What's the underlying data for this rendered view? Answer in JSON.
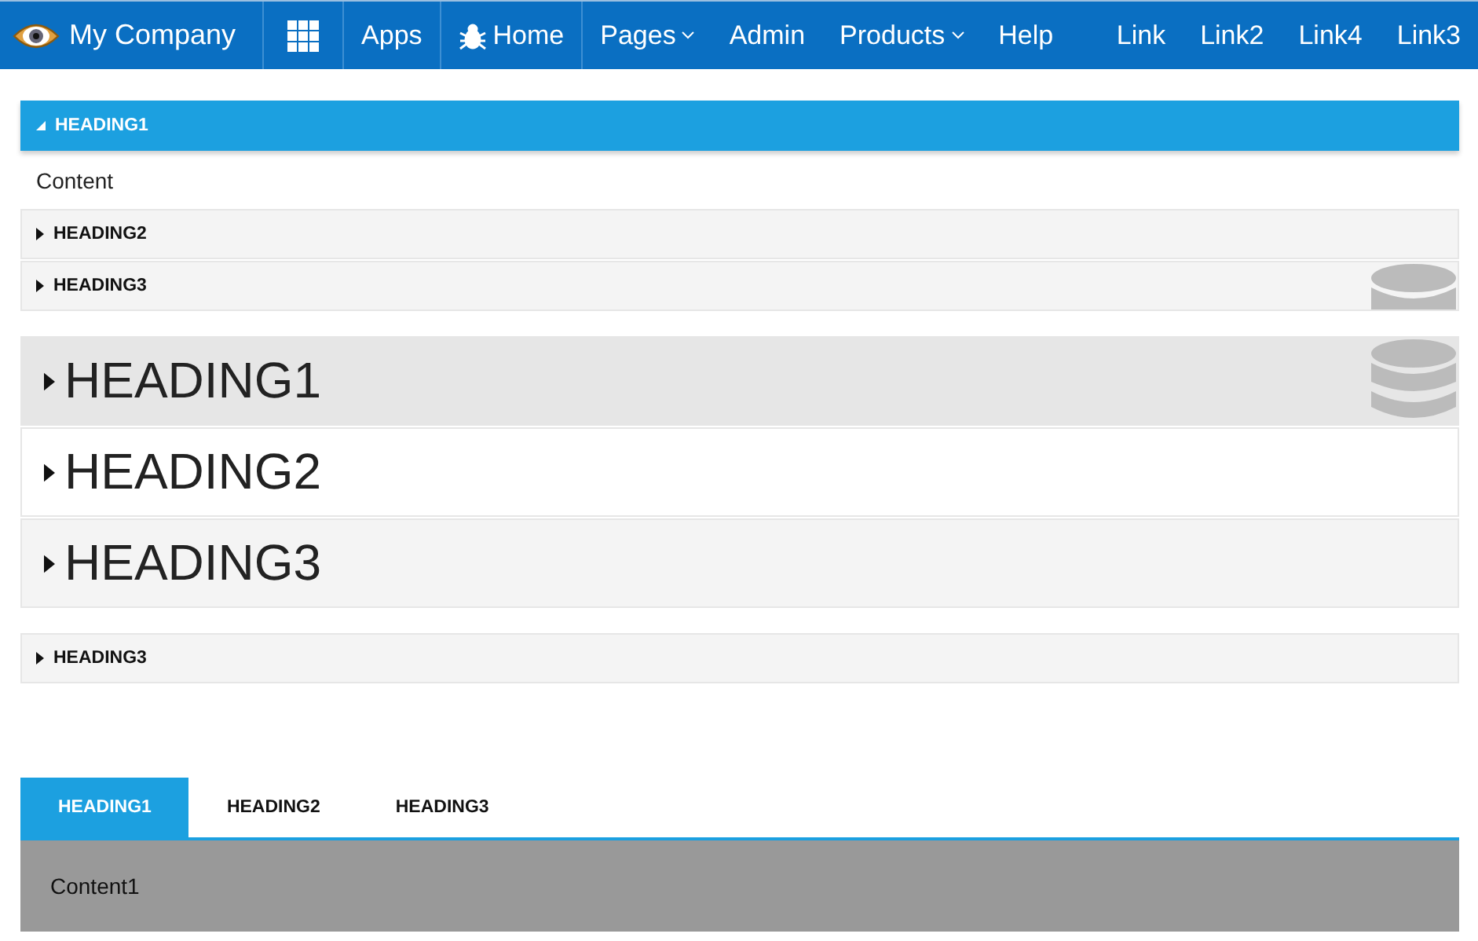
{
  "navbar": {
    "brand": "My Company",
    "items": [
      {
        "label": "Apps",
        "dropdown": false,
        "separated": true
      },
      {
        "label": "Home",
        "dropdown": false,
        "separated": true
      },
      {
        "label": "Pages",
        "dropdown": true
      },
      {
        "label": "Admin",
        "dropdown": false
      },
      {
        "label": "Products",
        "dropdown": true
      },
      {
        "label": "Help",
        "dropdown": false
      }
    ],
    "links": [
      "Link",
      "Link2",
      "Link4",
      "Link3"
    ]
  },
  "accordions": [
    {
      "kind": "small",
      "panels": [
        {
          "heading": "HEADING1",
          "expanded": true,
          "content": "Content"
        },
        {
          "heading": "HEADING2",
          "expanded": false
        },
        {
          "heading": "HEADING3",
          "expanded": false
        }
      ]
    },
    {
      "kind": "large",
      "panels": [
        {
          "heading": "HEADING1",
          "expanded": false,
          "hovered": true
        },
        {
          "heading": "HEADING2",
          "expanded": false,
          "hovered": false
        },
        {
          "heading": "HEADING3",
          "expanded": false,
          "hovered": false
        }
      ]
    },
    {
      "kind": "small",
      "panels": [
        {
          "heading": "HEADING3",
          "expanded": false
        }
      ]
    }
  ],
  "tabs": {
    "items": [
      {
        "label": "HEADING1",
        "selected": true
      },
      {
        "label": "HEADING2",
        "selected": false
      },
      {
        "label": "HEADING3",
        "selected": false
      }
    ],
    "content": "Content1"
  }
}
